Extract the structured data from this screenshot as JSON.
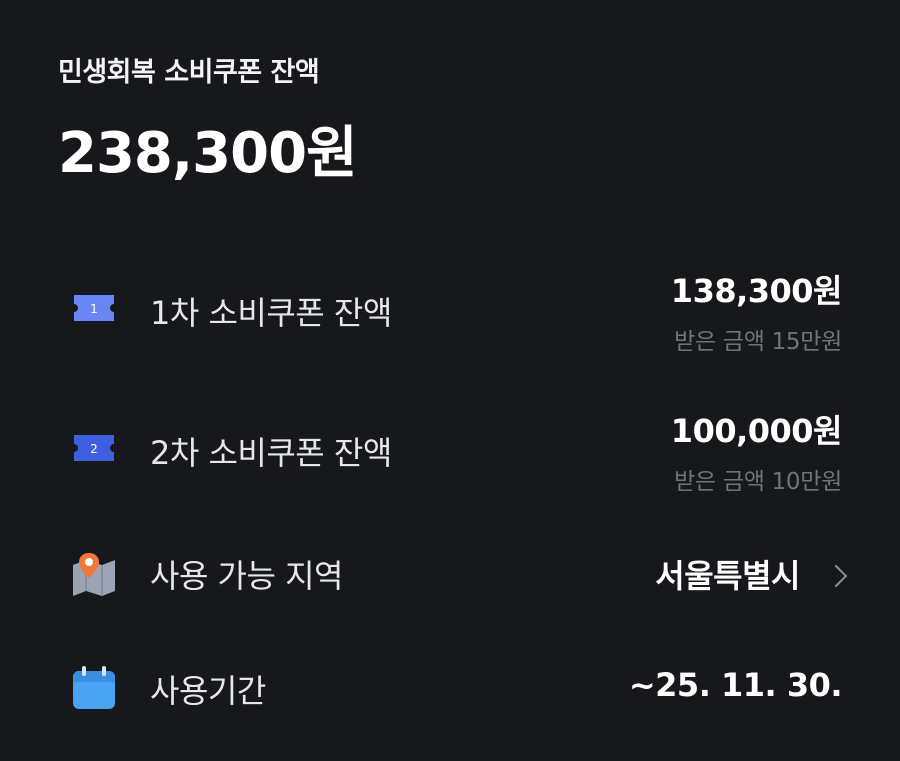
{
  "summary": {
    "label": "민생회복 소비쿠폰 잔액",
    "amount": "238,300원"
  },
  "rows": [
    {
      "icon": "ticket-1-icon",
      "icon_text": "1",
      "label": "1차 소비쿠폰 잔액",
      "value": "138,300원",
      "sub": "받은 금액 15만원"
    },
    {
      "icon": "ticket-2-icon",
      "icon_text": "2",
      "label": "2차 소비쿠폰 잔액",
      "value": "100,000원",
      "sub": "받은 금액 10만원"
    },
    {
      "icon": "map-pin-icon",
      "label": "사용 가능 지역",
      "value": "서울특별시"
    },
    {
      "icon": "calendar-icon",
      "label": "사용기간",
      "value": "~25. 11. 30."
    }
  ],
  "colors": {
    "background": "#17181c",
    "ticket1": "#6a86f2",
    "ticket2": "#3d5fe0",
    "pin": "#f2783a",
    "calendar": "#4aa3f2",
    "subtext": "#6f737b"
  }
}
